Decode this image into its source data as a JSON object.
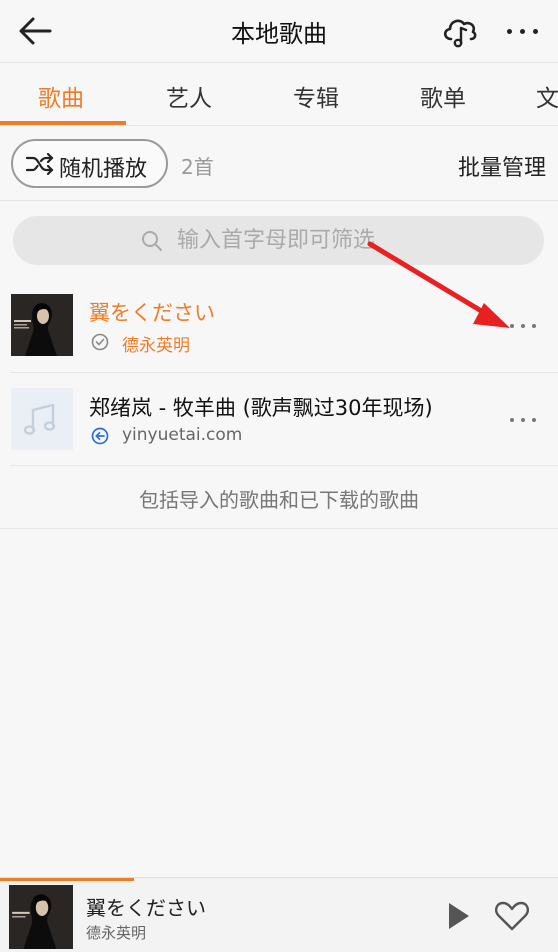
{
  "header": {
    "title": "本地歌曲"
  },
  "tabs": [
    {
      "label": "歌曲",
      "active": true
    },
    {
      "label": "艺人"
    },
    {
      "label": "专辑"
    },
    {
      "label": "歌单"
    },
    {
      "label": "文"
    }
  ],
  "toolbar": {
    "shuffle_label": "随机播放",
    "count": "2首",
    "batch_label": "批量管理"
  },
  "search": {
    "placeholder": "输入首字母即可筛选"
  },
  "songs": [
    {
      "title": "翼をください",
      "subtitle": "德永英明",
      "status_icon": "check-circle-icon",
      "playing": true
    },
    {
      "title": "郑绪岚 - 牧羊曲 (歌声飘过30年现场)",
      "subtitle": "yinyuetai.com",
      "status_icon": "back-arrow-circle-icon",
      "playing": false
    }
  ],
  "note": "包括导入的歌曲和已下载的歌曲",
  "player": {
    "title": "翼をください",
    "artist": "德永英明",
    "progress": 0.24
  },
  "colors": {
    "accent": "#f07c2a",
    "annotation_arrow": "#e8201f",
    "source_icon": "#2b6fd6"
  }
}
